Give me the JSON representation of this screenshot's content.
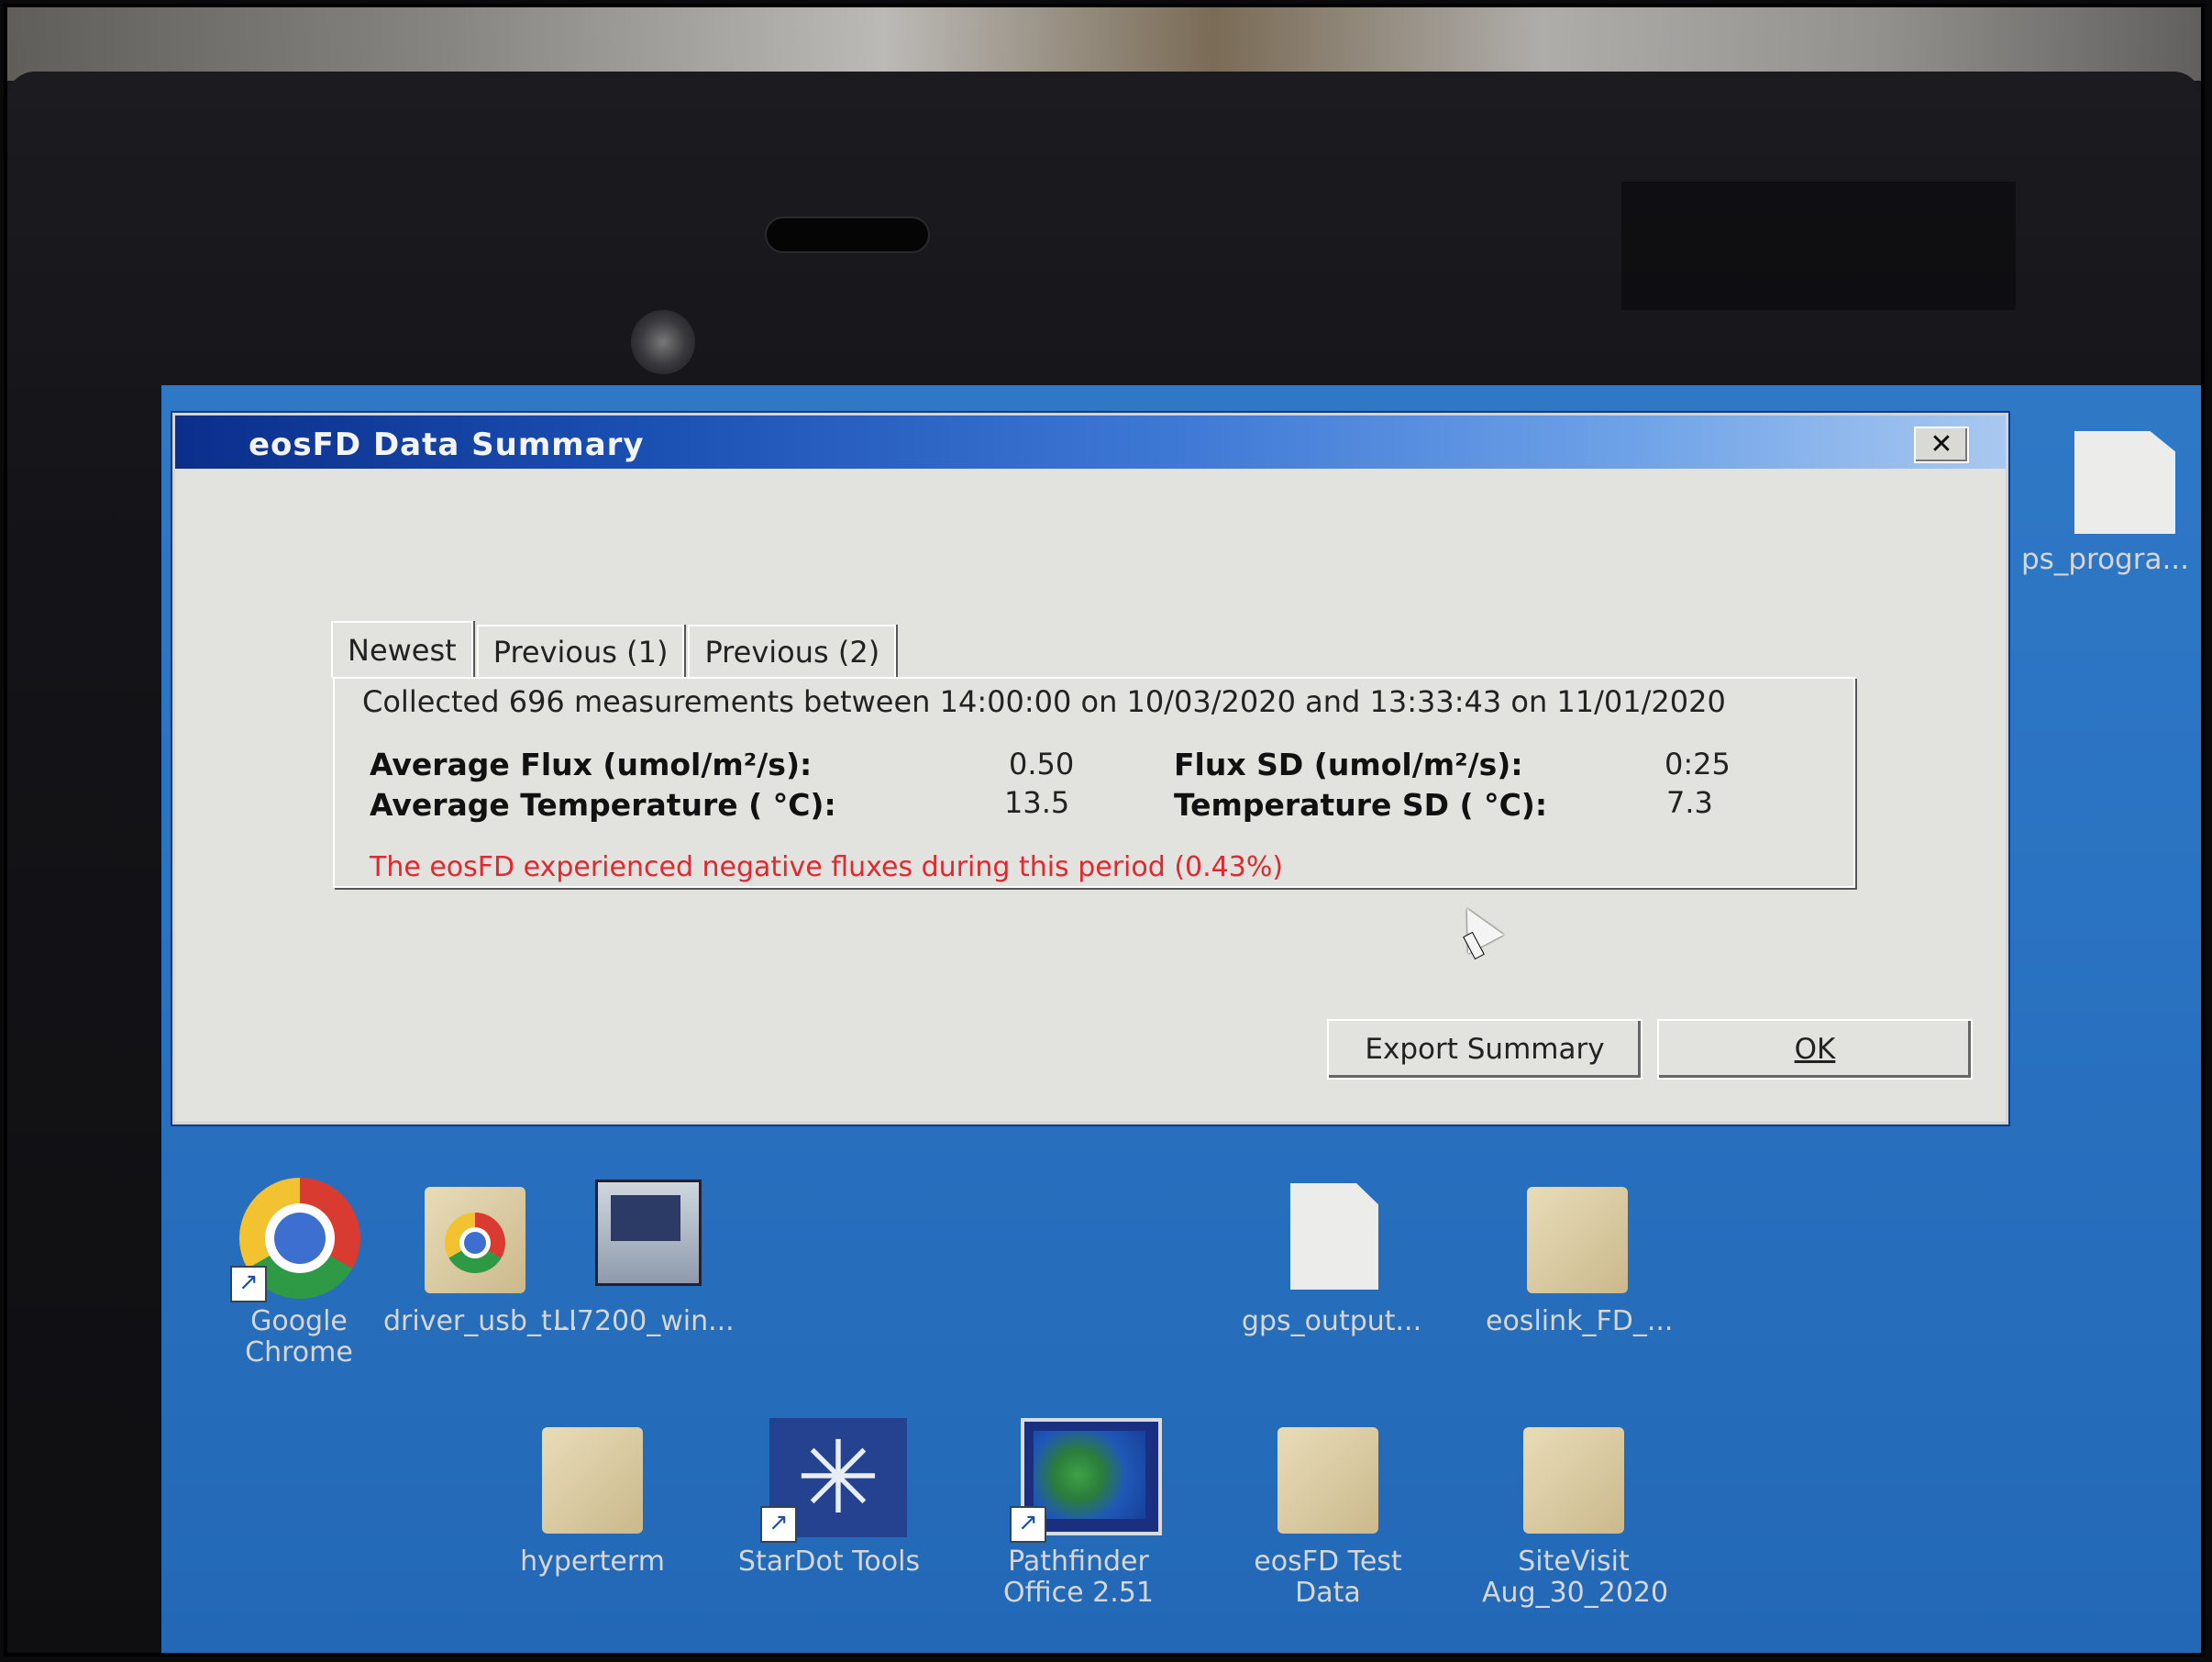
{
  "dialog": {
    "title": "eosFD Data Summary",
    "close_label": "✕",
    "tabs": [
      "Newest",
      "Previous (1)",
      "Previous (2)"
    ],
    "active_tab": "Newest",
    "summary": {
      "collected_text": "Collected 696 measurements between 14:00:00 on 10/03/2020 and 13:33:43 on 11/01/2020",
      "average_flux_label": "Average Flux (umol/m²/s):",
      "average_flux_value": "0.50",
      "average_temperature_label": "Average Temperature ( °C):",
      "average_temperature_value": "13.5",
      "flux_sd_label": "Flux SD (umol/m²/s):",
      "flux_sd_value": "0:25",
      "temperature_sd_label": "Temperature SD ( °C):",
      "temperature_sd_value": "7.3",
      "warning_text": "The eosFD experienced negative fluxes during this period (0.43%)"
    },
    "export_button_label": "Export Summary",
    "ok_button_label": "OK"
  },
  "desktop": {
    "icons": [
      {
        "label": "Google Chrome",
        "icon": "chrome-icon"
      },
      {
        "label": "driver_usb_t...",
        "icon": "folder-icon"
      },
      {
        "label": "LI7200_win...",
        "icon": "installer-icon"
      },
      {
        "label": "gps_output...",
        "icon": "file-icon"
      },
      {
        "label": "eoslink_FD_...",
        "icon": "folder-icon"
      },
      {
        "label": "hyperterm",
        "icon": "folder-icon"
      },
      {
        "label": "StarDot Tools",
        "icon": "stardot-icon"
      },
      {
        "label": "Pathfinder Office 2.51",
        "icon": "pathfinder-icon"
      },
      {
        "label": "eosFD Test Data",
        "icon": "folder-icon"
      },
      {
        "label": "SiteVisit Aug_30_2020",
        "icon": "folder-icon"
      }
    ],
    "right_icon": {
      "label": "ps_progra...",
      "icon": "file-icon"
    }
  },
  "colors": {
    "title_bar": "#1a4fb2",
    "desktop": "#2a73c2",
    "warning_text": "#e0282e",
    "dialog_bg": "#e2e2df"
  }
}
